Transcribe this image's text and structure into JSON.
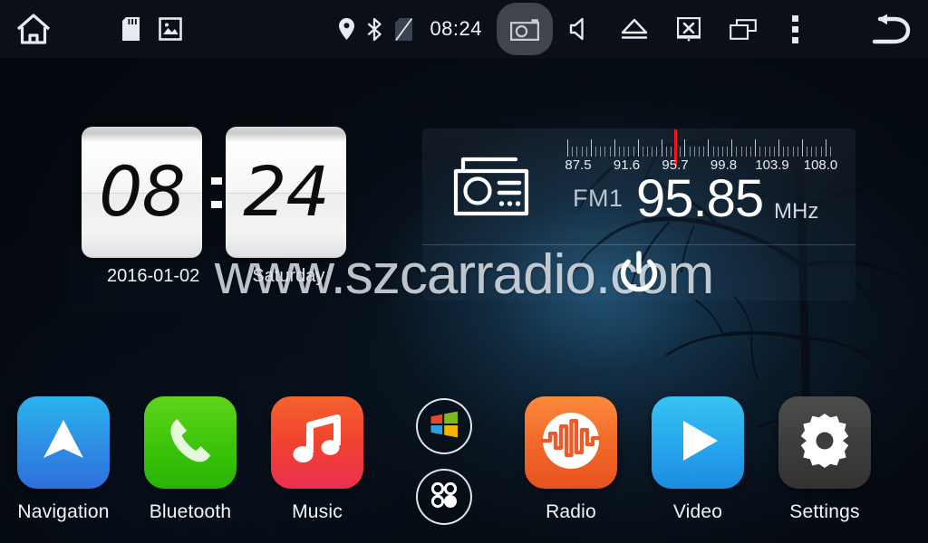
{
  "statusbar": {
    "icons_left": [
      {
        "name": "home-icon",
        "label": "Home"
      },
      {
        "name": "sd-card-icon",
        "label": "SD Card"
      },
      {
        "name": "gallery-icon",
        "label": "Gallery"
      }
    ],
    "icons_right": [
      {
        "name": "gps-icon",
        "label": "GPS"
      },
      {
        "name": "bluetooth-icon",
        "label": "Bluetooth"
      },
      {
        "name": "sim-card-off-icon",
        "label": "No SIM"
      }
    ],
    "clock": "08:24",
    "buttons": [
      {
        "name": "screenshot-button",
        "label": "Screenshot",
        "active": true
      },
      {
        "name": "volume-button",
        "label": "Volume"
      },
      {
        "name": "eject-button",
        "label": "Eject"
      },
      {
        "name": "screen-off-button",
        "label": "Screen Off"
      },
      {
        "name": "recent-apps-button",
        "label": "Recent Apps"
      },
      {
        "name": "more-options-button",
        "label": "More"
      },
      {
        "name": "back-button",
        "label": "Back"
      }
    ]
  },
  "clock_widget": {
    "hour": "08",
    "minute": "24",
    "colon": ":",
    "date": "2016-01-02",
    "weekday": "Saturday"
  },
  "radio_widget": {
    "icon_name": "radio-icon",
    "band": "FM1",
    "frequency": "95.85",
    "unit": "MHz",
    "scale_labels": [
      "87.5",
      "91.6",
      "95.7",
      "99.8",
      "103.9",
      "108.0"
    ],
    "scale_min": 87.5,
    "scale_max": 108.0,
    "needle_value": 95.85,
    "needle_color": "#f01718"
  },
  "watermark": {
    "text": "www.szcarradio.com"
  },
  "power_button": {
    "name": "power-button",
    "label": "Power"
  },
  "dock": {
    "apps": [
      {
        "label": "Navigation",
        "icon": "navigation-arrow-icon",
        "color": "#2e8ee4"
      },
      {
        "label": "Bluetooth",
        "icon": "phone-handset-icon",
        "color": "#3cc40a"
      },
      {
        "label": "Music",
        "icon": "music-note-icon",
        "color": "#f0432f"
      },
      {
        "label": "Radio",
        "icon": "waveform-icon",
        "color": "#f26a2a"
      },
      {
        "label": "Video",
        "icon": "play-triangle-icon",
        "color": "#27a7ec"
      },
      {
        "label": "Settings",
        "icon": "gear-icon",
        "color": "#3e3d3c"
      }
    ],
    "center_buttons": [
      {
        "name": "windows-button",
        "label": "Windows"
      },
      {
        "name": "all-apps-button",
        "label": "All Apps"
      }
    ]
  },
  "theme": {
    "statusbar_bg": "#0b0f16",
    "wallpaper_dark": "#060c16",
    "wallpaper_glow": "#347daa",
    "text_primary": "#f2f4f7",
    "accent_red": "#f01718"
  }
}
